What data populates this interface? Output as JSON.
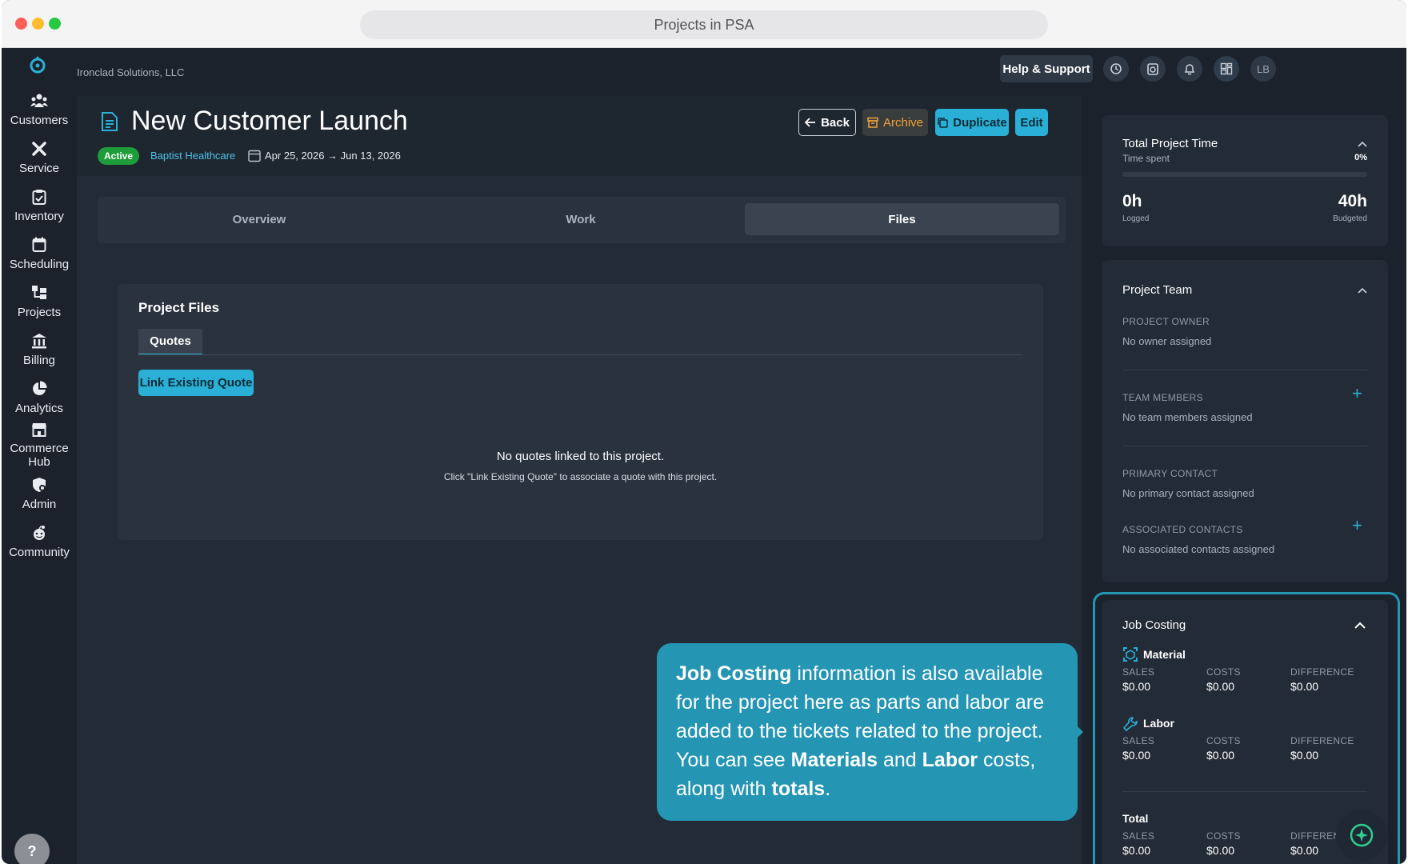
{
  "window": {
    "title": "Projects in PSA"
  },
  "topbar": {
    "company": "Ironclad Solutions, LLC",
    "help_label": "Help & Support",
    "avatar_initials": "LB"
  },
  "sidebar": {
    "items": [
      {
        "label": "Customers",
        "icon": "customers-icon"
      },
      {
        "label": "Service",
        "icon": "service-icon"
      },
      {
        "label": "Inventory",
        "icon": "inventory-icon"
      },
      {
        "label": "Scheduling",
        "icon": "scheduling-icon"
      },
      {
        "label": "Projects",
        "icon": "projects-icon"
      },
      {
        "label": "Billing",
        "icon": "billing-icon"
      },
      {
        "label": "Analytics",
        "icon": "analytics-icon"
      },
      {
        "label": "Commerce",
        "label2": "Hub",
        "icon": "commerce-icon"
      },
      {
        "label": "Admin",
        "icon": "admin-icon"
      },
      {
        "label": "Community",
        "icon": "community-icon"
      }
    ],
    "help_button": "?"
  },
  "project": {
    "title": "New Customer Launch",
    "status": "Active",
    "customer": "Baptist Healthcare",
    "date_range": "Apr 25, 2026 → Jun 13, 2026",
    "buttons": {
      "back": "Back",
      "archive": "Archive",
      "duplicate": "Duplicate",
      "edit": "Edit"
    }
  },
  "tabs": [
    {
      "label": "Overview",
      "active": false
    },
    {
      "label": "Work",
      "active": false
    },
    {
      "label": "Files",
      "active": true
    }
  ],
  "files": {
    "title": "Project Files",
    "subtab": "Quotes",
    "link_button": "Link Existing Quote",
    "empty_title": "No quotes linked to this project.",
    "empty_hint": "Click \"Link Existing Quote\" to associate a quote with this project."
  },
  "time_card": {
    "title": "Total Project Time",
    "subtitle": "Time spent",
    "percent": "0%",
    "progress_fraction": 0,
    "logged_value": "0h",
    "logged_label": "Logged",
    "budgeted_value": "40h",
    "budgeted_label": "Budgeted"
  },
  "team_card": {
    "title": "Project Team",
    "owner_label": "PROJECT OWNER",
    "owner_value": "No owner assigned",
    "members_label": "TEAM MEMBERS",
    "members_value": "No team members assigned",
    "primary_label": "PRIMARY CONTACT",
    "primary_value": "No primary contact assigned",
    "associated_label": "ASSOCIATED CONTACTS",
    "associated_value": "No associated contacts assigned"
  },
  "costing": {
    "title": "Job Costing",
    "material": {
      "label": "Material",
      "sales_label": "SALES",
      "sales": "$0.00",
      "costs_label": "COSTS",
      "costs": "$0.00",
      "diff_label": "DIFFERENCE",
      "diff": "$0.00"
    },
    "labor": {
      "label": "Labor",
      "sales_label": "SALES",
      "sales": "$0.00",
      "costs_label": "COSTS",
      "costs": "$0.00",
      "diff_label": "DIFFERENCE",
      "diff": "$0.00"
    },
    "total": {
      "label": "Total",
      "sales_label": "SALES",
      "sales": "$0.00",
      "costs_label": "COSTS",
      "costs": "$0.00",
      "diff_label": "DIFFEREN",
      "diff": "$0.00"
    }
  },
  "tooltip": {
    "b1": "Job Costing",
    "t1": " information is also available for the project here as parts and labor are added to the tickets related to the project. You can see ",
    "b2": "Materials",
    "t2": " and ",
    "b3": "Labor",
    "t3": " costs, along with ",
    "b4": "totals",
    "t4": "."
  },
  "colors": {
    "accent": "#2ab0d6",
    "status_green": "#1f9d3a",
    "archive": "#f0a23a",
    "tooltip": "#2595b4"
  }
}
